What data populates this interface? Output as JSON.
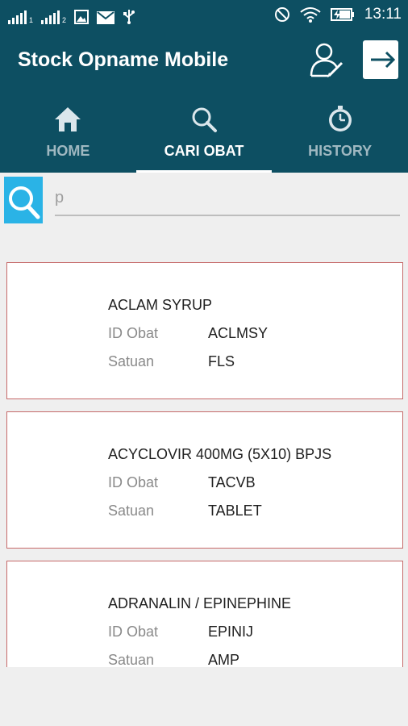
{
  "status_bar": {
    "time": "13:11",
    "sim1_label": "1",
    "sim2_label": "2"
  },
  "app": {
    "title": "Stock Opname Mobile",
    "theme_color": "#0d4f62",
    "accent_color": "#2ab3e6"
  },
  "tabs": [
    {
      "label": "HOME",
      "icon": "home-icon",
      "active": false
    },
    {
      "label": "CARI OBAT",
      "icon": "search-icon",
      "active": true
    },
    {
      "label": "HISTORY",
      "icon": "clock-icon",
      "active": false
    }
  ],
  "search": {
    "value": "p"
  },
  "items": [
    {
      "name": "ACLAM SYRUP",
      "id_label": "ID Obat",
      "id_value": "ACLMSY",
      "unit_label": "Satuan",
      "unit_value": "FLS"
    },
    {
      "name": "ACYCLOVIR 400MG (5X10) BPJS",
      "id_label": "ID Obat",
      "id_value": "TACVB",
      "unit_label": "Satuan",
      "unit_value": "TABLET"
    },
    {
      "name": "ADRANALIN / EPINEPHINE",
      "id_label": "ID Obat",
      "id_value": "EPINIJ",
      "unit_label": "Satuan",
      "unit_value": "AMP"
    }
  ]
}
